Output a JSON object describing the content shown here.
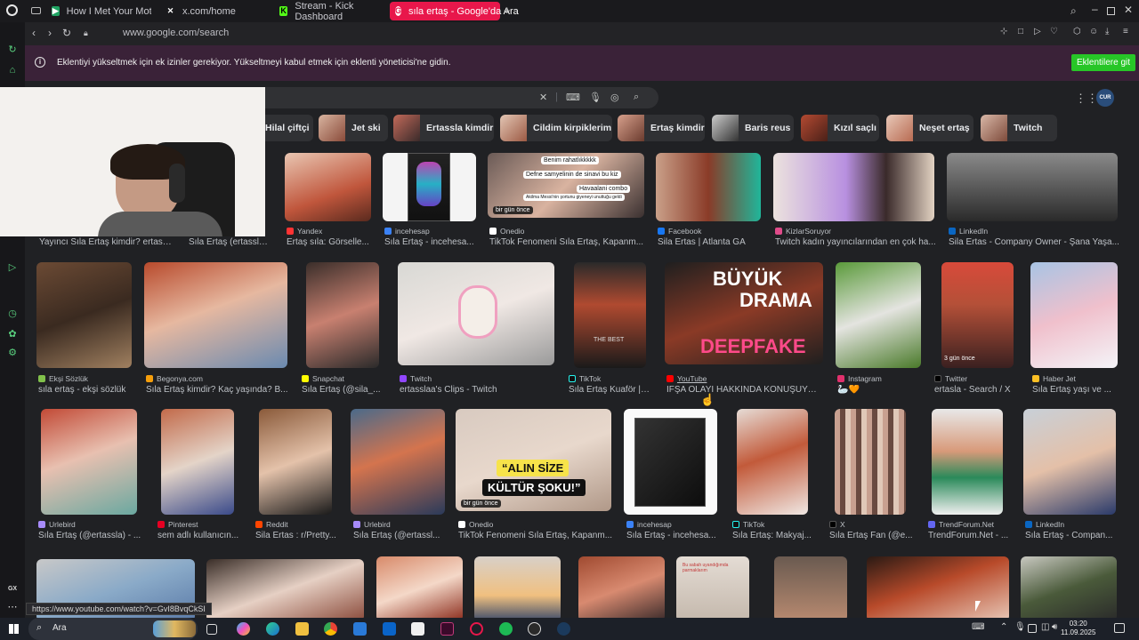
{
  "tabs": [
    {
      "label": "How I Met Your Mother 8",
      "icon": "tv-icon"
    },
    {
      "label": "x.com/home",
      "icon": "x-icon"
    },
    {
      "label": "Stream - Kick Dashboard",
      "icon": "kick-icon"
    },
    {
      "label": "sıla ertaş - Google'da Ara",
      "icon": "google-icon"
    }
  ],
  "address_bar": {
    "url": "www.google.com/search"
  },
  "extension_bar": {
    "message": "Eklentiyi yükseltmek için ek izinler gerekiyor. Yükseltmeyi kabul etmek için eklenti yöneticisi'ne gidin.",
    "button": "Eklentilere git"
  },
  "google": {
    "avatar_text": "CUR",
    "chips": [
      "Hilal çiftçi",
      "Jet ski",
      "Ertassla kimdir",
      "Cildim kirpiklerim",
      "Ertaş kimdir",
      "Baris reus",
      "Kızıl saçlı",
      "Neşet ertaş",
      "Twitch"
    ],
    "row1": [
      {
        "source": "",
        "title": "Yayıncı Sıla Ertaş kimdir? ertassl..."
      },
      {
        "source": "",
        "title": "Sıla Ertaş (ertassla..."
      },
      {
        "source": "Yandex",
        "title": "Ertaş sıla: Görselle..."
      },
      {
        "source": "incehesap",
        "title": "Sıla Ertaş - incehesa..."
      },
      {
        "source": "Onedio",
        "title": "TikTok Fenomeni Sıla Ertaş, Kapanm..."
      },
      {
        "source": "Facebook",
        "title": "Sila Ertas | Atlanta GA"
      },
      {
        "source": "KizlarSoruyor",
        "title": "Twitch kadın yayıncılarından en çok ha..."
      },
      {
        "source": "LinkedIn",
        "title": "Sila Ertas - Company Owner - Şana Yaşa..."
      }
    ],
    "row1_overlays": {
      "onedio_badge": "bir gün önce",
      "caption1": "Benim rahatlıkkkkk",
      "caption2": "Defne samyelinin de sinavi bu kiz",
      "caption3": "Havaalani combo",
      "caption4": "Akilma Messi'nin şortunu giyeneyi unuttuğu geldi"
    },
    "row2": [
      {
        "source": "Ekşi Sözlük",
        "title": "sıla ertaş - ekşi sözlük"
      },
      {
        "source": "Begonya.com",
        "title": "Sıla Ertaş kimdir? Kaç yaşında? B..."
      },
      {
        "source": "Snapchat",
        "title": "Sıla Ertaş (@sila_..."
      },
      {
        "source": "Twitch",
        "title": "ertasslaa's Clips - Twitch"
      },
      {
        "source": "TikTok",
        "title": "Sıla Ertaş Kuaför | ..."
      },
      {
        "source": "YouTube",
        "title": "İFŞA OLAYI HAKKINDA KONUŞUYO..."
      },
      {
        "source": "Instagram",
        "title": "🦢🧡"
      },
      {
        "source": "Twitter",
        "title": "ertasla - Search / X"
      },
      {
        "source": "Haber Jet",
        "title": "Sıla Ertaş yaşı ve ..."
      }
    ],
    "row2_overlays": {
      "youtube_top": "BÜYÜK",
      "youtube_mid": "DRAMA",
      "youtube_bottom": "DEEPFAKE",
      "twitter_badge": "3 gün önce",
      "thumb_text": "THE BEST"
    },
    "row3": [
      {
        "source": "Urlebird",
        "title": "Sıla Ertaş (@ertassla) - ..."
      },
      {
        "source": "Pinterest",
        "title": "sem adlı kullanıcın..."
      },
      {
        "source": "Reddit",
        "title": "Sila Ertas : r/Pretty..."
      },
      {
        "source": "Urlebird",
        "title": "Sıla Ertaş (@ertassl..."
      },
      {
        "source": "Onedio",
        "title": "TikTok Fenomeni Sıla Ertaş, Kapanm..."
      },
      {
        "source": "incehesap",
        "title": "Sıla Ertaş - incehesa..."
      },
      {
        "source": "TikTok",
        "title": "Sıla Ertaş: Makyaj..."
      },
      {
        "source": "X",
        "title": "Sıla Ertaş Fan (@e..."
      },
      {
        "source": "TrendForum.Net",
        "title": "TrendForum.Net - ..."
      },
      {
        "source": "LinkedIn",
        "title": "Sıla Ertaş - Compan..."
      }
    ],
    "row3_overlays": {
      "banner1": "“ALIN SİZE",
      "banner2": "KÜLTÜR ŞOKU!”",
      "onedio_badge": "bir gün önce"
    },
    "row4_overlay": "Bu sabah uyandığımda parmaklarım"
  },
  "status_url": "https://www.youtube.com/watch?v=GvI8BvqCkSI",
  "taskbar": {
    "search_placeholder": "Ara",
    "time": "03:20",
    "date": "11.09.2025"
  },
  "colors": {
    "active_tab": "#e8174b",
    "extension_bar": "#3a2238",
    "extension_button": "#27c627",
    "content_bg": "#202124"
  }
}
